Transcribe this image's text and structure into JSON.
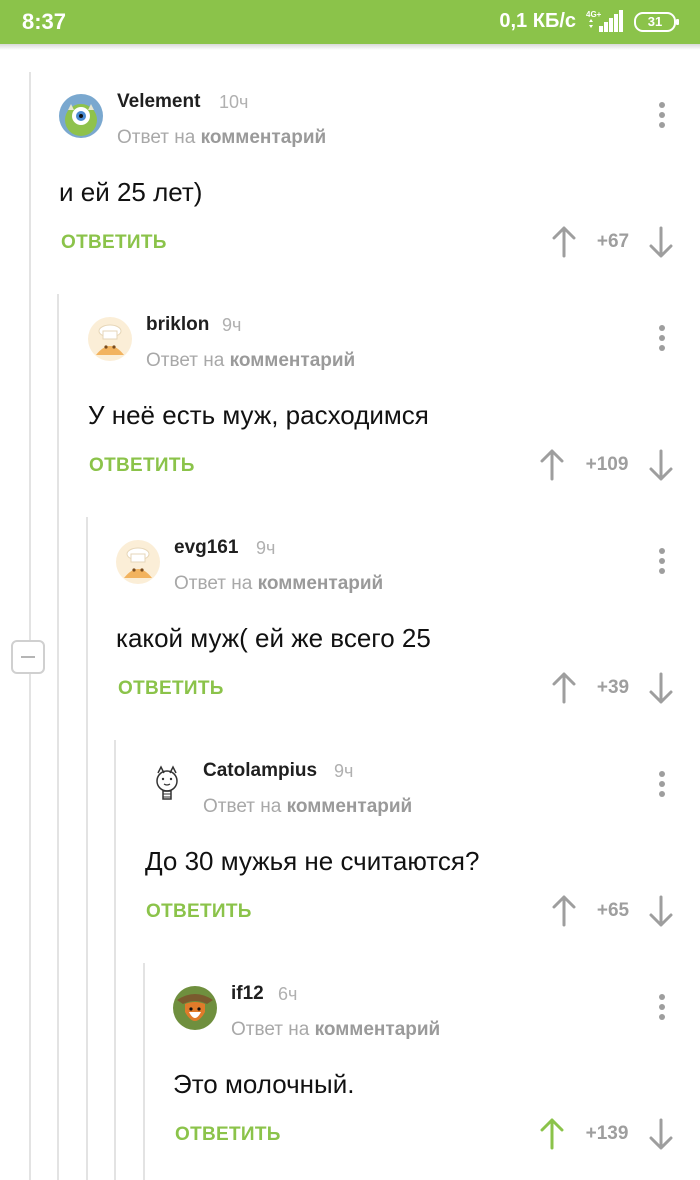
{
  "status_bar": {
    "time": "8:37",
    "network_speed": "0,1 КБ/с",
    "signal_type": "4G+",
    "battery": "31"
  },
  "comments": [
    {
      "username": "Velement",
      "time": "10ч",
      "reply_prefix": "Ответ на",
      "reply_target": "комментарий",
      "text": "и ей 25 лет)",
      "reply_label": "ОТВЕТИТЬ",
      "score": "+67",
      "avatar": "cyclops-monster-avatar",
      "upvoted": false
    },
    {
      "username": "briklon",
      "time": "9ч",
      "reply_prefix": "Ответ на",
      "reply_target": "комментарий",
      "text": "У неё есть муж, расходимся",
      "reply_label": "ОТВЕТИТЬ",
      "score": "+109",
      "avatar": "default-chef-avatar",
      "upvoted": false
    },
    {
      "username": "evg161",
      "time": "9ч",
      "reply_prefix": "Ответ на",
      "reply_target": "комментарий",
      "text": "какой муж( ей же всего 25",
      "reply_label": "ОТВЕТИТЬ",
      "score": "+39",
      "avatar": "default-chef-avatar",
      "upvoted": false
    },
    {
      "username": "Catolampius",
      "time": "9ч",
      "reply_prefix": "Ответ на",
      "reply_target": "комментарий",
      "text": "До 30 мужья не считаются?",
      "reply_label": "ОТВЕТИТЬ",
      "score": "+65",
      "avatar": "cat-lightbulb-avatar",
      "upvoted": false
    },
    {
      "username": "if12",
      "time": "6ч",
      "reply_prefix": "Ответ на",
      "reply_target": "комментарий",
      "text": "Это молочный.",
      "reply_label": "ОТВЕТИТЬ",
      "score": "+139",
      "avatar": "fox-hat-avatar",
      "upvoted": true
    }
  ],
  "colors": {
    "accent": "#8bc34a",
    "muted": "#9e9e9e",
    "thread_line": "#e3e3e3"
  }
}
